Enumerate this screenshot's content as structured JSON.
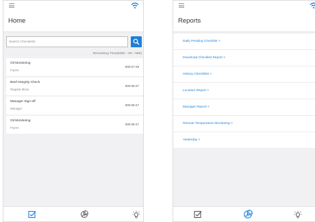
{
  "colors": {
    "accent": "#1e7fd8",
    "background": "#f1f1f3",
    "card": "#ffffff"
  },
  "home": {
    "title": "Home",
    "search": {
      "placeholder": "Search Checklists",
      "value": ""
    },
    "remaining_label": "Remaining Time(DDD : HH : MM)",
    "checklists": [
      {
        "title": "Oil Monitoring",
        "subtitle": "Fryers",
        "time": "000:07:48"
      },
      {
        "title": "Beef Integrity Check",
        "subtitle": "Regular Menu",
        "time": "000:08:47"
      },
      {
        "title": "Manager Sign-off",
        "subtitle": "Manager",
        "time": "000:08:47"
      },
      {
        "title": "Oil Monitoring",
        "subtitle": "Fryers",
        "time": "000:08:47"
      }
    ],
    "nav": {
      "active": "checklist-icon",
      "icons": [
        "checklist-icon",
        "reports-icon",
        "lightbulb-icon"
      ]
    }
  },
  "reports": {
    "title": "Reports",
    "items": [
      "Daily Pending Checklist  >",
      "Download Checklist Report  >",
      "History Checklists  >",
      "Location Report  >",
      "Manager Report  >",
      "Remote Temperature Monitoring  >",
      "Yesterday  >"
    ],
    "nav": {
      "active": "reports-icon"
    }
  }
}
